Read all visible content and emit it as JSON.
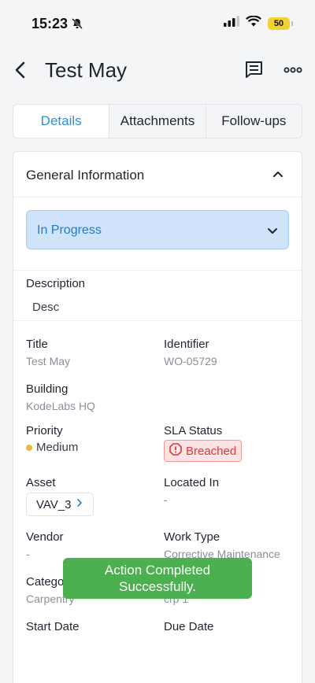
{
  "status_bar": {
    "time": "15:23",
    "battery": "50"
  },
  "nav": {
    "title": "Test May"
  },
  "tabs": [
    {
      "label": "Details"
    },
    {
      "label": "Attachments"
    },
    {
      "label": "Follow-ups"
    }
  ],
  "general": {
    "section_title": "General Information",
    "status": "In Progress",
    "description_label": "Description",
    "description_value": "Desc",
    "title_label": "Title",
    "title_value": "Test May",
    "identifier_label": "Identifier",
    "identifier_value": "WO-05729",
    "building_label": "Building",
    "building_value": "KodeLabs HQ",
    "priority_label": "Priority",
    "priority_value": "Medium",
    "sla_label": "SLA Status",
    "sla_value": "Breached",
    "asset_label": "Asset",
    "asset_value": "VAV_3",
    "located_label": "Located In",
    "located_value": "-",
    "vendor_label": "Vendor",
    "vendor_value": "-",
    "work_type_label": "Work Type",
    "work_type_value": "Corrective Maintenance",
    "category_label": "Catego",
    "category_value": "Carpentry",
    "subcategory_value": "crp 1",
    "start_date_label": "Start Date",
    "due_date_label": "Due Date"
  },
  "toast": {
    "line1": "Action Completed",
    "line2": "Successfully."
  },
  "colors": {
    "accent": "#2e8fd8",
    "status_bg": "#cfe4fb",
    "breached": "#d83b3b",
    "priority_medium": "#f0b942",
    "toast_bg": "#4caf50"
  }
}
